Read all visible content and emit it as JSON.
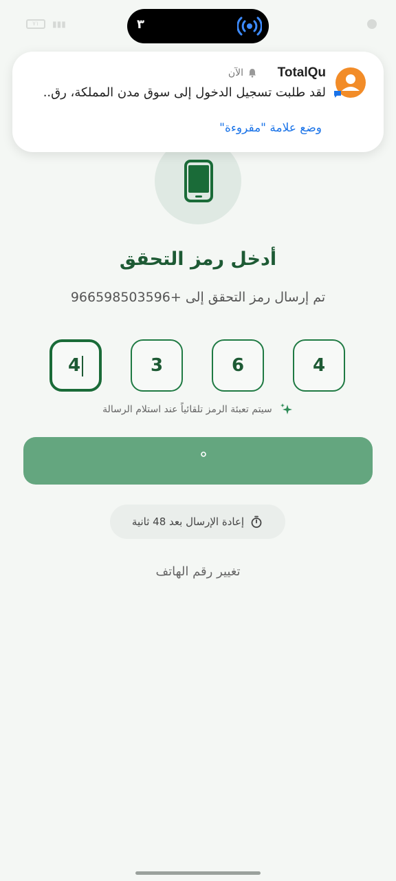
{
  "status_bar": {
    "island_counter": "٣",
    "broadcast_icon": "broadcast-icon",
    "battery_label": "٧١"
  },
  "notification": {
    "app_name": "TotalQu",
    "time": "الآن",
    "body": "لقد طلبت تسجيل الدخول إلى سوق مدن المملكة، رق...",
    "action": "وضع علامة \"مقروءة\"",
    "avatar_color": "#f28c28"
  },
  "screen": {
    "title": "أدخل رمز التحقق",
    "subtitle": "تم إرسال رمز التحقق إلى +966598503596",
    "otp_digits": [
      "4",
      "6",
      "3",
      "4"
    ],
    "autofill_hint": "سيتم تعبئة الرمز تلقائياً عند استلام الرسالة",
    "submit_loading_glyph": "٠",
    "resend_label": "إعادة الإرسال بعد 48 ثانية",
    "change_phone": "تغيير رقم الهاتف"
  },
  "colors": {
    "primary": "#1d5a34",
    "button": "#64a67f",
    "background": "#f4f7f4",
    "link": "#1a73e8"
  }
}
